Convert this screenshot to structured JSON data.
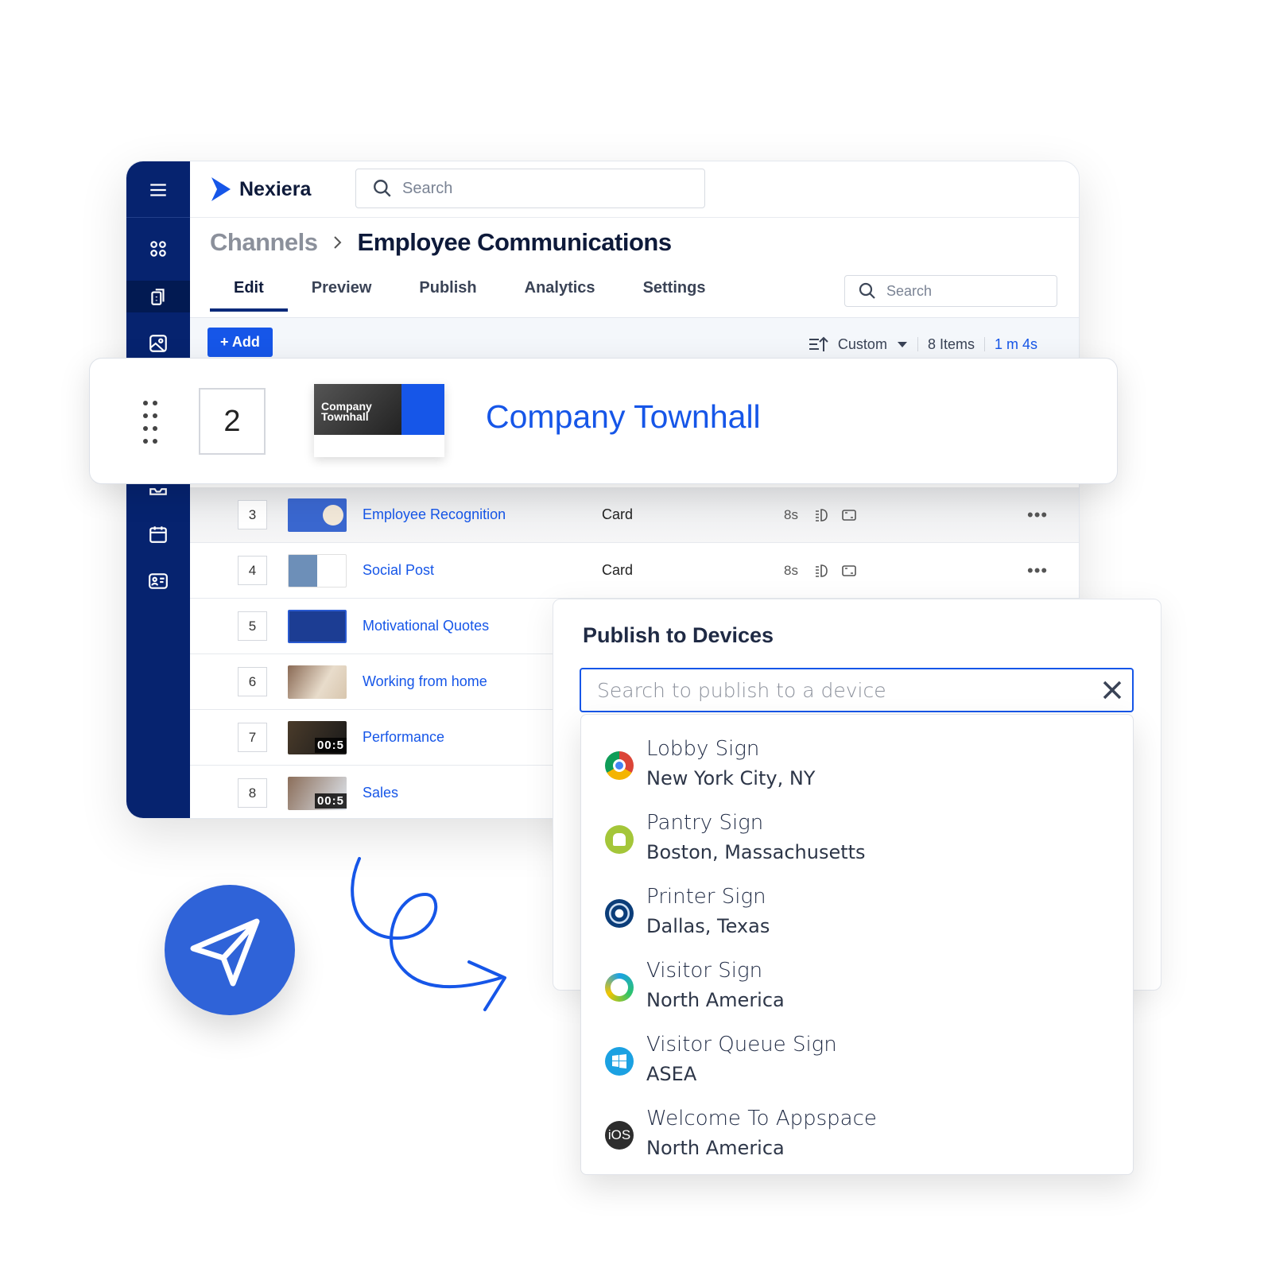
{
  "app": {
    "name": "Nexiera",
    "search_placeholder": "Search"
  },
  "sidebar": {
    "icons": [
      "menu-icon",
      "apps-icon",
      "channels-icon",
      "media-icon",
      "inbox-icon",
      "calendar-icon",
      "id-card-icon"
    ],
    "active": "channels-icon"
  },
  "breadcrumb": {
    "parent": "Channels",
    "current": "Employee Communications"
  },
  "tabs": [
    {
      "label": "Edit",
      "active": true
    },
    {
      "label": "Preview"
    },
    {
      "label": "Publish"
    },
    {
      "label": "Analytics"
    },
    {
      "label": "Settings"
    }
  ],
  "tab_search_placeholder": "Search",
  "toolbar": {
    "add_label": "+ Add",
    "sort_label": "Custom",
    "items_count": "8 Items",
    "total_duration": "1 m 4s"
  },
  "dragged_item": {
    "index": "2",
    "title": "Company Townhall",
    "thumb_title": "Company Townhall"
  },
  "rows": [
    {
      "index": "3",
      "title": "Employee Recognition",
      "type": "Card",
      "duration": "8s"
    },
    {
      "index": "4",
      "title": "Social Post",
      "type": "Card",
      "duration": "8s"
    },
    {
      "index": "5",
      "title": "Motivational Quotes"
    },
    {
      "index": "6",
      "title": "Working from home"
    },
    {
      "index": "7",
      "title": "Performance",
      "video_time": "00:5"
    },
    {
      "index": "8",
      "title": "Sales",
      "video_time": "00:5"
    }
  ],
  "publish": {
    "title": "Publish to Devices",
    "search_placeholder": "Search to publish to a device",
    "devices": [
      {
        "name": "Lobby Sign",
        "location": "New York City, NY",
        "platform": "chrome-icon"
      },
      {
        "name": "Pantry Sign",
        "location": "Boston, Massachusetts",
        "platform": "android-icon"
      },
      {
        "name": "Printer Sign",
        "location": "Dallas, Texas",
        "platform": "webos-icon"
      },
      {
        "name": "Visitor Sign",
        "location": "North America",
        "platform": "tizen-icon"
      },
      {
        "name": "Visitor Queue Sign",
        "location": "ASEA",
        "platform": "windows-icon"
      },
      {
        "name": "Welcome To Appspace",
        "location": "North America",
        "platform": "ios-icon"
      }
    ]
  },
  "colors": {
    "sidebar": "#06236f",
    "accent": "#1656e8",
    "send_button": "#2f63d8"
  }
}
